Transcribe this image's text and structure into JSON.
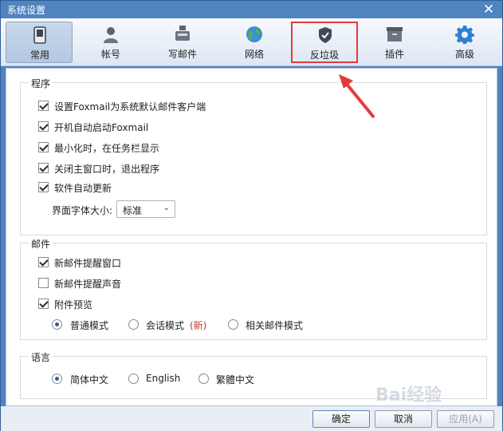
{
  "window": {
    "title": "系统设置",
    "close_glyph": "✕"
  },
  "toolbar": {
    "tabs": [
      {
        "label": "常用",
        "icon": "phone-icon"
      },
      {
        "label": "帐号",
        "icon": "user-icon"
      },
      {
        "label": "写邮件",
        "icon": "compose-icon"
      },
      {
        "label": "网络",
        "icon": "globe-icon"
      },
      {
        "label": "反垃圾",
        "icon": "shield-icon"
      },
      {
        "label": "插件",
        "icon": "box-icon"
      },
      {
        "label": "高级",
        "icon": "gear-icon"
      }
    ],
    "active_tab": "常用",
    "highlighted_tab": "反垃圾"
  },
  "program": {
    "title": "程序",
    "options": [
      {
        "label": "设置Foxmail为系统默认邮件客户端",
        "checked": true
      },
      {
        "label": "开机自动启动Foxmail",
        "checked": true
      },
      {
        "label": "最小化时，在任务栏显示",
        "checked": true
      },
      {
        "label": "关闭主窗口时，退出程序",
        "checked": true
      },
      {
        "label": "软件自动更新",
        "checked": true
      }
    ],
    "font_size_label": "界面字体大小:",
    "font_size_value": "标准"
  },
  "mail": {
    "title": "邮件",
    "options": [
      {
        "label": "新邮件提醒窗口",
        "checked": true
      },
      {
        "label": "新邮件提醒声音",
        "checked": false
      },
      {
        "label": "附件预览",
        "checked": true
      }
    ],
    "modes": {
      "normal": "普通模式",
      "conversation": "会话模式",
      "conversation_new_badge": "(新)",
      "related": "相关邮件模式",
      "selected": "普通模式"
    }
  },
  "language": {
    "title": "语言",
    "options": [
      "简体中文",
      "English",
      "繁體中文"
    ],
    "selected": "简体中文"
  },
  "footer": {
    "ok": "确定",
    "cancel": "取消",
    "apply": "应用(A)"
  },
  "watermark": "Bai经验",
  "colors": {
    "annotation_red": "#e33b3b",
    "title_bar_blue": "#4f84c0"
  }
}
